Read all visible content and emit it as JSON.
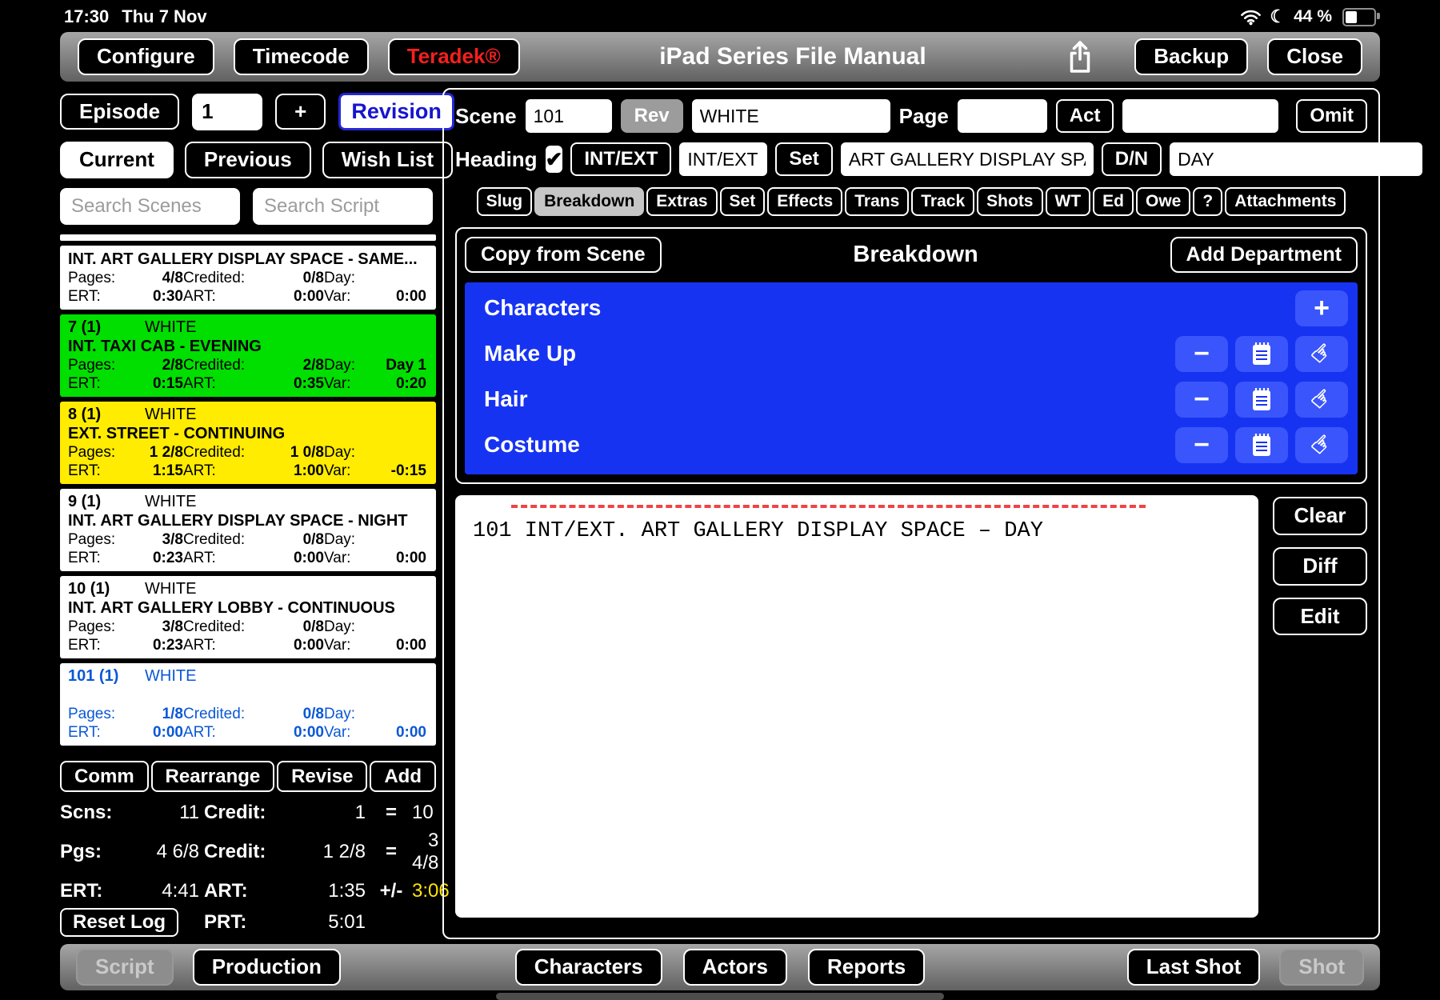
{
  "status_bar": {
    "time": "17:30",
    "date": "Thu 7 Nov",
    "battery": "44 %"
  },
  "icons": {
    "check": "✔",
    "plus": "+",
    "minus": "−",
    "hand": "☞",
    "moon": "☾"
  },
  "top_toolbar": {
    "configure": "Configure",
    "timecode": "Timecode",
    "teradek": "Teradek®",
    "title": "iPad Series File Manual",
    "backup": "Backup",
    "close": "Close"
  },
  "left_panel": {
    "episode_label": "Episode",
    "episode_value": "1",
    "add_episode": "+",
    "revision": "Revision",
    "view_tabs": {
      "current": "Current",
      "previous": "Previous",
      "wish_list": "Wish List"
    },
    "search_scenes_placeholder": "Search Scenes",
    "search_script_placeholder": "Search Script",
    "stat_labels": {
      "pages": "Pages:",
      "credited": "Credited:",
      "day": "Day:",
      "ert": "ERT:",
      "art": "ART:",
      "var": "Var:"
    },
    "scenes": [
      {
        "number": "",
        "revision": "",
        "slug": "INT. ART GALLERY DISPLAY SPACE - SAME...",
        "pages": "4/8",
        "credited": "0/8",
        "day": "",
        "ert": "0:30",
        "art": "0:00",
        "var": "0:00",
        "color": "white",
        "partial": true
      },
      {
        "number": "7 (1)",
        "revision": "WHITE",
        "slug": "INT. TAXI CAB - EVENING",
        "pages": "2/8",
        "credited": "2/8",
        "day": "Day 1",
        "ert": "0:15",
        "art": "0:35",
        "var": "0:20",
        "color": "green"
      },
      {
        "number": "8 (1)",
        "revision": "WHITE",
        "slug": "EXT. STREET - CONTINUING",
        "pages": "1 2/8",
        "credited": "1 0/8",
        "day": "",
        "ert": "1:15",
        "art": "1:00",
        "var": "-0:15",
        "color": "yellow"
      },
      {
        "number": "9 (1)",
        "revision": "WHITE",
        "slug": "INT. ART GALLERY DISPLAY SPACE - NIGHT",
        "pages": "3/8",
        "credited": "0/8",
        "day": "",
        "ert": "0:23",
        "art": "0:00",
        "var": "0:00",
        "color": "white"
      },
      {
        "number": "10 (1)",
        "revision": "WHITE",
        "slug": "INT. ART GALLERY LOBBY - CONTINUOUS",
        "pages": "3/8",
        "credited": "0/8",
        "day": "",
        "ert": "0:23",
        "art": "0:00",
        "var": "0:00",
        "color": "white"
      },
      {
        "number": "101 (1)",
        "revision": "WHITE",
        "slug": "",
        "pages": "1/8",
        "credited": "0/8",
        "day": "",
        "ert": "0:00",
        "art": "0:00",
        "var": "0:00",
        "color": "sel"
      }
    ],
    "actions": {
      "comm": "Comm",
      "rearrange": "Rearrange",
      "revise": "Revise",
      "add": "Add"
    },
    "totals": {
      "scns_label": "Scns:",
      "scns": "11",
      "credit1_label": "Credit:",
      "credit1": "1",
      "eq1": "=",
      "total1": "10",
      "pgs_label": "Pgs:",
      "pgs": "4 6/8",
      "credit2_label": "Credit:",
      "credit2": "1 2/8",
      "eq2": "=",
      "total2": "3 4/8",
      "ert_label": "ERT:",
      "ert": "4:41",
      "art_label": "ART:",
      "art": "1:35",
      "plusminus": "+/-",
      "diff": "3:06",
      "reset_log": "Reset Log",
      "prt_label": "PRT:",
      "prt": "5:01"
    }
  },
  "scene_editor": {
    "scene_label": "Scene",
    "scene_number": "101",
    "rev_button": "Rev",
    "revision_value": "WHITE",
    "page_label": "Page",
    "page_value": "",
    "act_button": "Act",
    "act_value": "",
    "omit_button": "Omit",
    "heading_label": "Heading",
    "intext_button": "INT/EXT",
    "intext_value": "INT/EXT",
    "set_button": "Set",
    "set_value": "ART GALLERY DISPLAY SPACE",
    "dn_button": "D/N",
    "dn_value": "DAY",
    "tabs": [
      "Slug",
      "Breakdown",
      "Extras",
      "Set",
      "Effects",
      "Trans",
      "Track",
      "Shots",
      "WT",
      "Ed",
      "Owe",
      "?",
      "Attachments"
    ],
    "active_tab": "Breakdown"
  },
  "breakdown": {
    "copy_from_scene": "Copy from Scene",
    "title": "Breakdown",
    "add_department": "Add Department",
    "departments": [
      {
        "name": "Characters",
        "buttons": [
          "add"
        ]
      },
      {
        "name": "Make Up",
        "buttons": [
          "remove",
          "notes",
          "assign"
        ]
      },
      {
        "name": "Hair",
        "buttons": [
          "remove",
          "notes",
          "assign"
        ]
      },
      {
        "name": "Costume",
        "buttons": [
          "remove",
          "notes",
          "assign"
        ]
      }
    ]
  },
  "script_area": {
    "text": "101 INT/EXT. ART GALLERY DISPLAY SPACE – DAY",
    "buttons": {
      "clear": "Clear",
      "diff": "Diff",
      "edit": "Edit"
    }
  },
  "bottom_toolbar": {
    "script": "Script",
    "production": "Production",
    "characters": "Characters",
    "actors": "Actors",
    "reports": "Reports",
    "last_shot": "Last Shot",
    "shot": "Shot"
  },
  "colors": {
    "panel_blue": "#1733f2",
    "scene_green": "#00df00",
    "scene_yellow": "#ffec00",
    "selected_scene_blue": "#0a58d6",
    "teradek_red": "#f51f1f",
    "variance_yellow": "#ffe400",
    "dashed_line_red": "#ee4545"
  }
}
